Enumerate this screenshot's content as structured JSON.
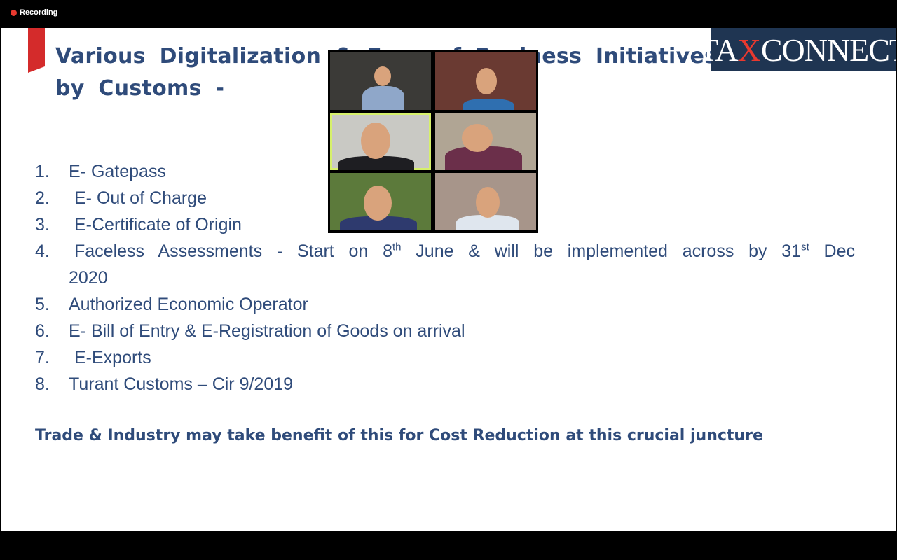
{
  "recording": {
    "label": "Recording"
  },
  "slide": {
    "title": "Various Digitalization & Ease of Business Initiatives by Customs -",
    "logo": {
      "left": "TA",
      "x": "X",
      "right": "CONNECT"
    },
    "items": [
      {
        "num": "1.",
        "text": "E- Gatepass"
      },
      {
        "num": "2.",
        "text": "E- Out of Charge"
      },
      {
        "num": "3.",
        "text": "E-Certificate of Origin"
      },
      {
        "num": "4.",
        "text_a": "Faceless Assessments - Start on 8",
        "sup_a": "th",
        "text_b": " June & will be implemented across by 31",
        "sup_b": "st",
        "text_c": " Dec",
        "text_d": "2020"
      },
      {
        "num": "5.",
        "text": "Authorized Economic Operator"
      },
      {
        "num": "6.",
        "text": "E- Bill of Entry & E-Registration of Goods on arrival"
      },
      {
        "num": "7.",
        "text": "E-Exports"
      },
      {
        "num": "8.",
        "text": "Turant Customs – Cir 9/2019"
      }
    ],
    "footer": "Trade & Industry may take benefit of this for Cost Reduction at this crucial juncture"
  },
  "colors": {
    "accent": "#d42b2b",
    "text": "#2f4b7a",
    "active_speaker": "#d6f06b"
  },
  "gallery": {
    "participants": [
      {
        "name": "participant-1",
        "bg": "#3b3a37",
        "shirt": "#8fa7c9"
      },
      {
        "name": "participant-2",
        "bg": "#6a3a32",
        "shirt": "#2f6fb0"
      },
      {
        "name": "participant-3",
        "bg": "#c9c9c4",
        "shirt": "#1e1e22",
        "active": true
      },
      {
        "name": "participant-4",
        "bg": "#b0a594",
        "shirt": "#6b2f4a"
      },
      {
        "name": "participant-5",
        "bg": "#5c7a3b",
        "shirt": "#2e3a6e"
      },
      {
        "name": "participant-6",
        "bg": "#a7958a",
        "shirt": "#dfe6ee"
      }
    ]
  }
}
